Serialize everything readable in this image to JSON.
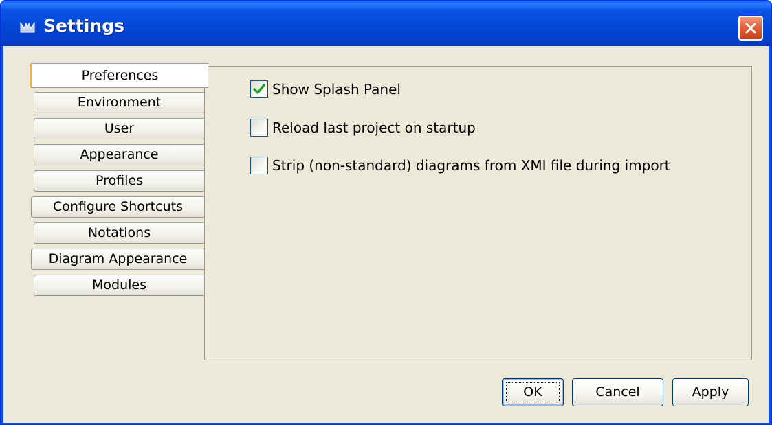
{
  "window": {
    "title": "Settings",
    "icon": "uml-app-icon",
    "close_icon": "close-icon",
    "accent_colors": {
      "titlebar": "#0a4de0",
      "close": "#e3613d",
      "selected_tab_marker": "#f6ae3b",
      "check": "#21a121"
    }
  },
  "tabs": [
    {
      "label": "Preferences",
      "selected": true
    },
    {
      "label": "Environment",
      "selected": false
    },
    {
      "label": "User",
      "selected": false
    },
    {
      "label": "Appearance",
      "selected": false
    },
    {
      "label": "Profiles",
      "selected": false
    },
    {
      "label": "Configure Shortcuts",
      "selected": false
    },
    {
      "label": "Notations",
      "selected": false
    },
    {
      "label": "Diagram Appearance",
      "selected": false
    },
    {
      "label": "Modules",
      "selected": false
    }
  ],
  "preferences": {
    "options": [
      {
        "label": "Show Splash Panel",
        "checked": true
      },
      {
        "label": "Reload last project on startup",
        "checked": false
      },
      {
        "label": "Strip (non-standard) diagrams from XMI file during import",
        "checked": false
      }
    ]
  },
  "buttons": {
    "ok": {
      "label": "OK",
      "mnemonic": "O"
    },
    "cancel": {
      "label": "Cancel",
      "mnemonic": "C"
    },
    "apply": {
      "label": "Apply",
      "mnemonic": "A"
    }
  }
}
